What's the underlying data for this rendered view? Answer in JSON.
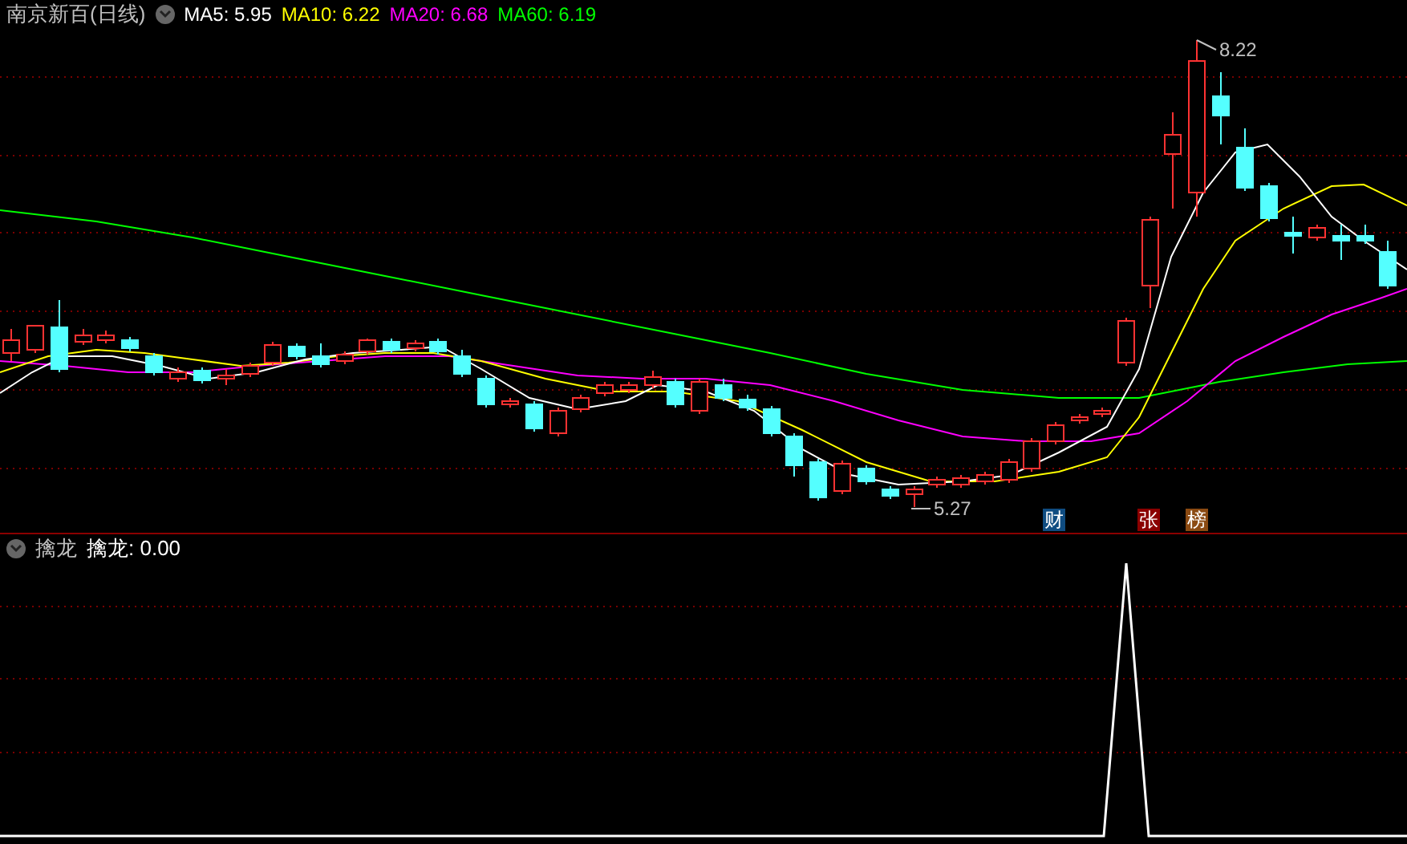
{
  "title": "南京新百(日线)",
  "ma_values": [
    {
      "text": "MA5: 5.95",
      "color": "#ffffff"
    },
    {
      "text": "MA10: 6.22",
      "color": "#ffff00"
    },
    {
      "text": "MA20: 6.68",
      "color": "#ff00ff"
    },
    {
      "text": "MA60: 6.19",
      "color": "#00ff00"
    }
  ],
  "high_label": "8.22",
  "low_label": "5.27",
  "badges": [
    {
      "text": "财",
      "color": "#0f4c81"
    },
    {
      "text": "张",
      "color": "#8b0000"
    },
    {
      "text": "榜",
      "color": "#8b4a12"
    }
  ],
  "indicator": {
    "title": "擒龙",
    "reading": "擒龙: 0.00"
  }
}
